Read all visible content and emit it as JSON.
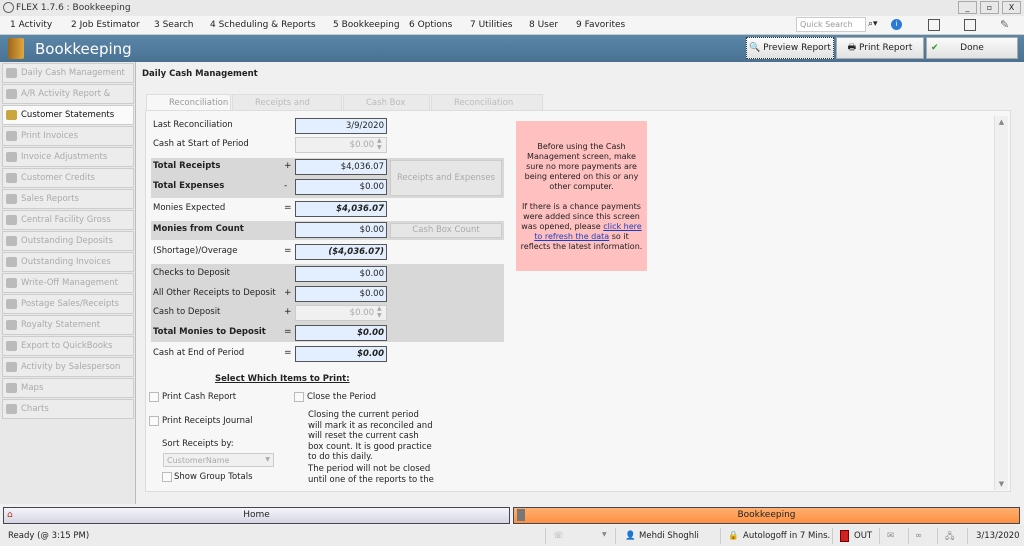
{
  "window": {
    "title": "FLEX 1.7.6 : Bookkeeping",
    "minimize": "_",
    "restore": "▫",
    "close": "X"
  },
  "menu": [
    "1 Activity",
    "2 Job Estimator",
    "3 Search",
    "4 Scheduling & Reports",
    "5 Bookkeeping",
    "6 Options",
    "7 Utilities",
    "8 User",
    "9 Favorites"
  ],
  "quick_search": {
    "placeholder": "Quick Search"
  },
  "header": {
    "title": "Bookkeeping",
    "preview": "Preview Report",
    "print": "Print Report",
    "done": "Done"
  },
  "sidebar": [
    "Daily Cash Management",
    "A/R Activity Report & Search",
    "Customer Statements",
    "Print Invoices",
    "Invoice Adjustments",
    "Customer Credits",
    "Sales Reports",
    "Central Facility Gross Profit",
    "Outstanding Deposits",
    "Outstanding Invoices",
    "Write-Off Management",
    "Postage Sales/Receipts",
    "Royalty Statement",
    "Export to QuickBooks",
    "Activity by Salesperson",
    "Maps",
    "Charts"
  ],
  "page_title": "Daily Cash Management",
  "tabs": [
    "Reconciliation",
    "Receipts and Expenses",
    "Cash Box Count",
    "Reconciliation History"
  ],
  "form": {
    "last_reconciliation": {
      "label": "Last Reconciliation",
      "value": "3/9/2020"
    },
    "cash_start": {
      "label": "Cash at Start of Period",
      "value": "$0.00"
    },
    "total_receipts": {
      "label": "Total Receipts",
      "op": "+",
      "value": "$4,036.07"
    },
    "total_expenses": {
      "label": "Total Expenses",
      "op": "-",
      "value": "$0.00"
    },
    "monies_expected": {
      "label": "Monies Expected",
      "op": "=",
      "value": "$4,036.07"
    },
    "monies_count": {
      "label": "Monies from Count",
      "value": "$0.00"
    },
    "shortage": {
      "label": "(Shortage)/Overage",
      "op": "=",
      "value": "($4,036.07)"
    },
    "checks": {
      "label": "Checks to Deposit",
      "value": "$0.00"
    },
    "other_receipts": {
      "label": "All Other Receipts to Deposit",
      "op": "+",
      "value": "$0.00"
    },
    "cash_deposit": {
      "label": "Cash to Deposit",
      "op": "+",
      "value": "$0.00"
    },
    "total_deposit": {
      "label": "Total Monies to Deposit",
      "op": "=",
      "value": "$0.00"
    },
    "cash_end": {
      "label": "Cash at End of Period",
      "op": "=",
      "value": "$0.00"
    },
    "receipts_btn": "Receipts and Expenses",
    "cashbox_btn": "Cash Box Count"
  },
  "notice": {
    "p1": "Before using the Cash Management screen, make sure no more payments are being entered on this or any other computer.",
    "p2a": "If there is a chance payments were added since this screen was opened, please ",
    "link": "click here to refresh the data",
    "p2b": " so it reflects the latest information."
  },
  "print": {
    "title": "Select Which Items to Print:",
    "cash_report": "Print Cash Report",
    "receipts_journal": "Print Receipts Journal",
    "sort_label": "Sort Receipts by:",
    "sort_value": "CustomerName",
    "group_totals": "Show Group Totals",
    "close_period": "Close the Period",
    "close_text1": "Closing the current period will mark it as reconciled and will reset the current cash box count.  It is good practice to do this daily.",
    "close_text2": "The period will not be closed until one of the reports to the"
  },
  "nav": {
    "home": "Home",
    "bookkeeping": "Bookkeeping"
  },
  "status": {
    "ready": "Ready  (@ 3:15 PM)",
    "user": "Mehdi Shoghli",
    "autologoff": "Autologoff in 7 Mins.",
    "out": "OUT",
    "date": "3/13/2020"
  },
  "colors": {
    "header": "#4a7192",
    "active_nav": "#ff9a4a",
    "notice": "#ffc0c0",
    "input": "#e3efff"
  }
}
